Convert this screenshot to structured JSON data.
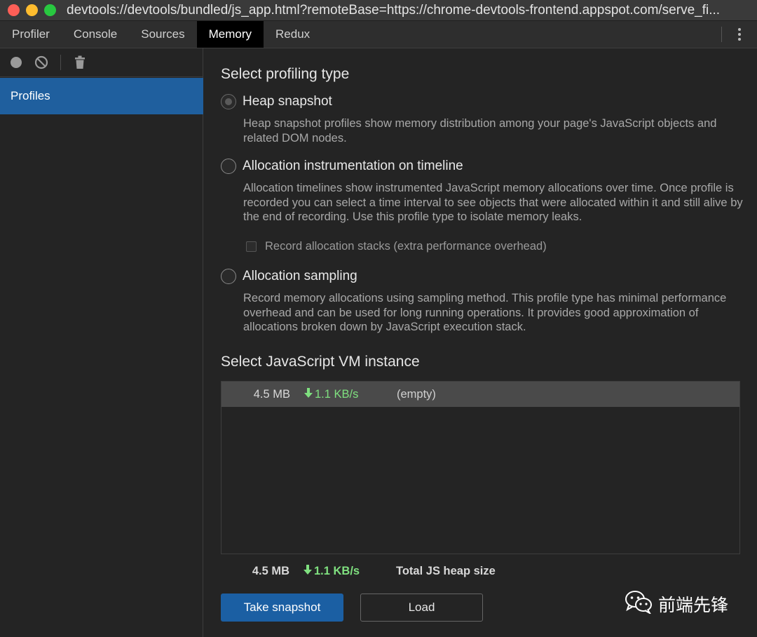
{
  "window": {
    "title": "devtools://devtools/bundled/js_app.html?remoteBase=https://chrome-devtools-frontend.appspot.com/serve_fi..."
  },
  "tabs": [
    {
      "label": "Profiler"
    },
    {
      "label": "Console"
    },
    {
      "label": "Sources"
    },
    {
      "label": "Memory",
      "active": true
    },
    {
      "label": "Redux"
    }
  ],
  "sidebar": {
    "toolbar": {
      "record_icon": "record-dot-icon",
      "clear_icon": "no-entry-icon",
      "delete_icon": "trash-icon"
    },
    "items": [
      {
        "label": "Profiles",
        "selected": true
      }
    ]
  },
  "main": {
    "select_type_title": "Select profiling type",
    "options": [
      {
        "label": "Heap snapshot",
        "checked": true,
        "description": "Heap snapshot profiles show memory distribution among your page's JavaScript objects and related DOM nodes."
      },
      {
        "label": "Allocation instrumentation on timeline",
        "checked": false,
        "description": "Allocation timelines show instrumented JavaScript memory allocations over time. Once profile is recorded you can select a time interval to see objects that were allocated within it and still alive by the end of recording. Use this profile type to isolate memory leaks.",
        "sub_option": {
          "label": "Record allocation stacks (extra performance overhead)",
          "checked": false
        }
      },
      {
        "label": "Allocation sampling",
        "checked": false,
        "description": "Record memory allocations using sampling method. This profile type has minimal performance overhead and can be used for long running operations. It provides good approximation of allocations broken down by JavaScript execution stack."
      }
    ],
    "vm_title": "Select JavaScript VM instance",
    "vm_instances": [
      {
        "size": "4.5 MB",
        "rate": "1.1 KB/s",
        "name": "(empty)"
      }
    ],
    "summary": {
      "size": "4.5 MB",
      "rate": "1.1 KB/s",
      "label": "Total JS heap size"
    },
    "buttons": {
      "take_snapshot": "Take snapshot",
      "load": "Load"
    }
  },
  "watermark": {
    "text": "前端先锋",
    "icon": "wechat-icon"
  },
  "colors": {
    "accent": "#1b5fa3",
    "selected": "#1f5f9e",
    "rate_green": "#7fe07f"
  }
}
